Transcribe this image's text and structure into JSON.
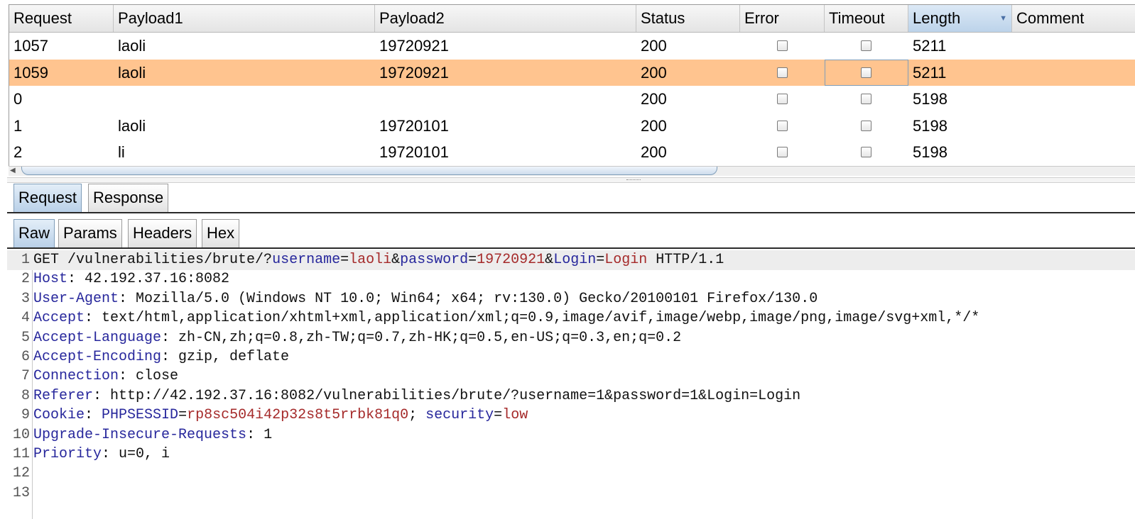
{
  "results_table": {
    "columns": [
      "Request",
      "Payload1",
      "Payload2",
      "Status",
      "Error",
      "Timeout",
      "Length",
      "Comment"
    ],
    "sorted_column": "Length",
    "rows": [
      {
        "request": "1057",
        "payload1": "laoli",
        "payload2": "19720921",
        "status": "200",
        "error": false,
        "timeout": false,
        "length": "5211",
        "comment": "",
        "selected": false
      },
      {
        "request": "1059",
        "payload1": "laoli",
        "payload2": "19720921",
        "status": "200",
        "error": false,
        "timeout": false,
        "length": "5211",
        "comment": "",
        "selected": true
      },
      {
        "request": "0",
        "payload1": "",
        "payload2": "",
        "status": "200",
        "error": false,
        "timeout": false,
        "length": "5198",
        "comment": "",
        "selected": false
      },
      {
        "request": "1",
        "payload1": "laoli",
        "payload2": "19720101",
        "status": "200",
        "error": false,
        "timeout": false,
        "length": "5198",
        "comment": "",
        "selected": false
      },
      {
        "request": "2",
        "payload1": "li",
        "payload2": "19720101",
        "status": "200",
        "error": false,
        "timeout": false,
        "length": "5198",
        "comment": "",
        "selected": false
      }
    ]
  },
  "message_tabs": [
    "Request",
    "Response"
  ],
  "active_message_tab": "Request",
  "view_tabs": [
    "Raw",
    "Params",
    "Headers",
    "Hex"
  ],
  "active_view_tab": "Raw",
  "colors": {
    "selected_row": "#ffc48f",
    "header_key": "#27279c",
    "param_value": "#a52a2a"
  },
  "request_lines": [
    [
      [
        "p",
        "GET /vulnerabilities/brute/?"
      ],
      [
        "k",
        "username"
      ],
      [
        "p",
        "="
      ],
      [
        "v",
        "laoli"
      ],
      [
        "p",
        "&"
      ],
      [
        "k",
        "password"
      ],
      [
        "p",
        "="
      ],
      [
        "v",
        "19720921"
      ],
      [
        "p",
        "&"
      ],
      [
        "k",
        "Login"
      ],
      [
        "p",
        "="
      ],
      [
        "v",
        "Login"
      ],
      [
        "p",
        " HTTP/1.1"
      ]
    ],
    [
      [
        "k",
        "Host"
      ],
      [
        "p",
        ": 42.192.37.16:8082"
      ]
    ],
    [
      [
        "k",
        "User-Agent"
      ],
      [
        "p",
        ": Mozilla/5.0 (Windows NT 10.0; Win64; x64; rv:130.0) Gecko/20100101 Firefox/130.0"
      ]
    ],
    [
      [
        "k",
        "Accept"
      ],
      [
        "p",
        ": text/html,application/xhtml+xml,application/xml;q=0.9,image/avif,image/webp,image/png,image/svg+xml,*/*"
      ]
    ],
    [
      [
        "k",
        "Accept-Language"
      ],
      [
        "p",
        ": zh-CN,zh;q=0.8,zh-TW;q=0.7,zh-HK;q=0.5,en-US;q=0.3,en;q=0.2"
      ]
    ],
    [
      [
        "k",
        "Accept-Encoding"
      ],
      [
        "p",
        ": gzip, deflate"
      ]
    ],
    [
      [
        "k",
        "Connection"
      ],
      [
        "p",
        ": close"
      ]
    ],
    [
      [
        "k",
        "Referer"
      ],
      [
        "p",
        ": http://42.192.37.16:8082/vulnerabilities/brute/?username=1&password=1&Login=Login"
      ]
    ],
    [
      [
        "k",
        "Cookie"
      ],
      [
        "p",
        ": "
      ],
      [
        "k",
        "PHPSESSID"
      ],
      [
        "p",
        "="
      ],
      [
        "v",
        "rp8sc504i42p32s8t5rrbk81q0"
      ],
      [
        "p",
        "; "
      ],
      [
        "k",
        "security"
      ],
      [
        "p",
        "="
      ],
      [
        "v",
        "low"
      ]
    ],
    [
      [
        "k",
        "Upgrade-Insecure-Requests"
      ],
      [
        "p",
        ": 1"
      ]
    ],
    [
      [
        "k",
        "Priority"
      ],
      [
        "p",
        ": u=0, i"
      ]
    ],
    [],
    []
  ]
}
